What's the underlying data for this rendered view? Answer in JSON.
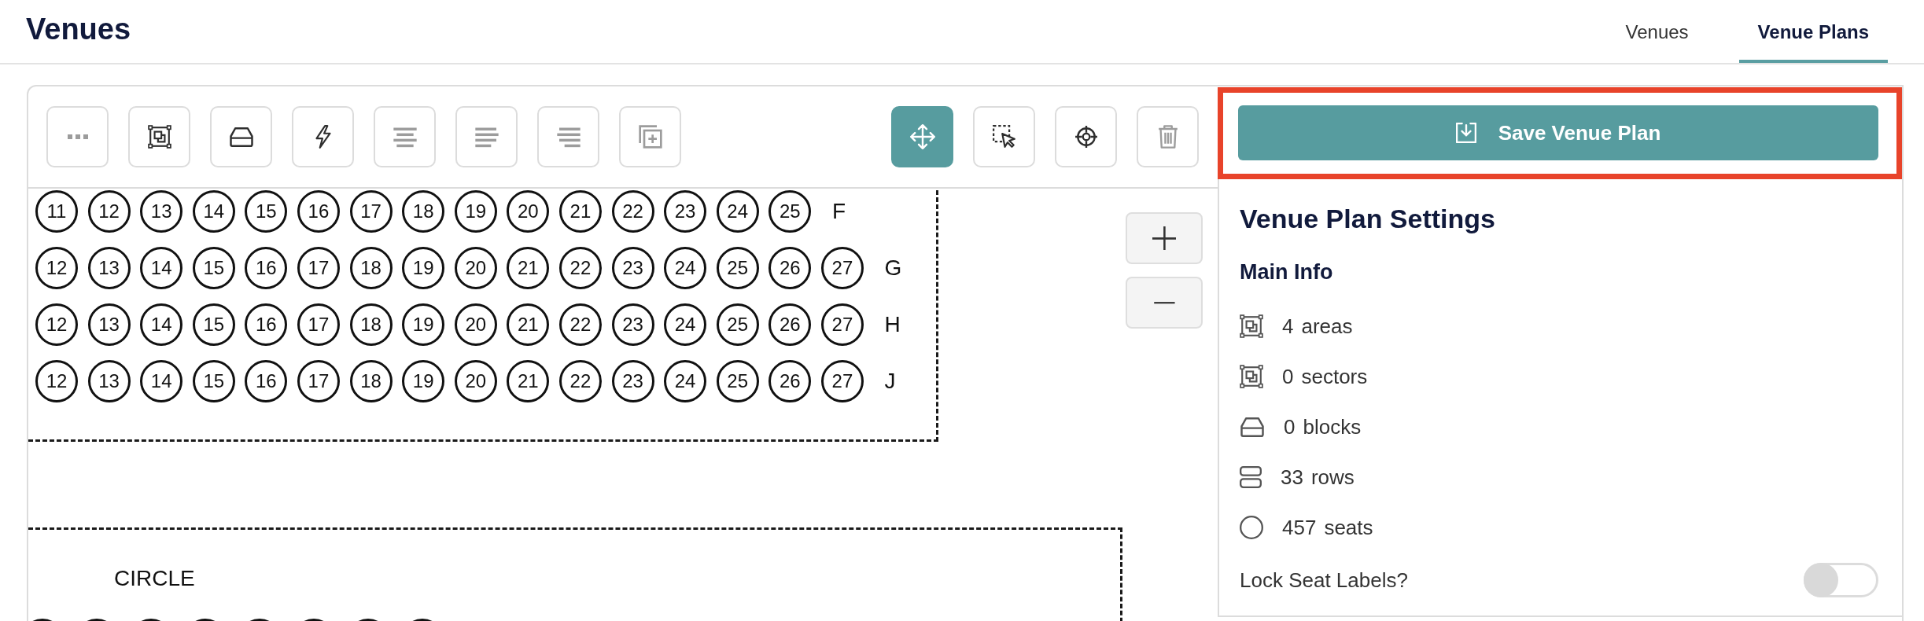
{
  "header": {
    "title": "Venues",
    "tabs": [
      {
        "label": "Venues",
        "selected": false
      },
      {
        "label": "Venue Plans",
        "selected": true
      }
    ]
  },
  "toolbar": {
    "tools": [
      {
        "kind": "more",
        "disabled": true,
        "selected": false
      },
      {
        "kind": "area",
        "disabled": false,
        "selected": false
      },
      {
        "kind": "block",
        "disabled": false,
        "selected": false
      },
      {
        "kind": "lightning",
        "disabled": false,
        "selected": false
      },
      {
        "kind": "align-center",
        "disabled": true,
        "selected": false
      },
      {
        "kind": "align-left",
        "disabled": true,
        "selected": false
      },
      {
        "kind": "align-right",
        "disabled": true,
        "selected": false
      },
      {
        "kind": "copy",
        "disabled": true,
        "selected": false
      }
    ],
    "tools_right": [
      {
        "kind": "move",
        "disabled": false,
        "selected": true
      },
      {
        "kind": "select",
        "disabled": false,
        "selected": false
      },
      {
        "kind": "target",
        "disabled": false,
        "selected": false
      },
      {
        "kind": "delete",
        "disabled": true,
        "selected": false
      }
    ]
  },
  "seat_map": {
    "section": {
      "rows": [
        {
          "label": "F",
          "seats": [
            "11",
            "12",
            "13",
            "14",
            "15",
            "16",
            "17",
            "18",
            "19",
            "20",
            "21",
            "22",
            "23",
            "24",
            "25"
          ]
        },
        {
          "label": "G",
          "seats": [
            "12",
            "13",
            "14",
            "15",
            "16",
            "17",
            "18",
            "19",
            "20",
            "21",
            "22",
            "23",
            "24",
            "25",
            "26",
            "27"
          ]
        },
        {
          "label": "H",
          "seats": [
            "12",
            "13",
            "14",
            "15",
            "16",
            "17",
            "18",
            "19",
            "20",
            "21",
            "22",
            "23",
            "24",
            "25",
            "26",
            "27"
          ]
        },
        {
          "label": "J",
          "seats": [
            "12",
            "13",
            "14",
            "15",
            "16",
            "17",
            "18",
            "19",
            "20",
            "21",
            "22",
            "23",
            "24",
            "25",
            "26",
            "27"
          ]
        }
      ]
    },
    "circle_section": {
      "label": "CIRCLE"
    }
  },
  "save_button": {
    "label": "Save Venue Plan",
    "highlighted": true
  },
  "settings": {
    "title": "Venue Plan Settings",
    "subtitle": "Main Info",
    "stats": [
      {
        "kind": "area",
        "count": "4",
        "label": "areas"
      },
      {
        "kind": "sector",
        "count": "0",
        "label": "sectors"
      },
      {
        "kind": "block",
        "count": "0",
        "label": "blocks"
      },
      {
        "kind": "row",
        "count": "33",
        "label": "rows"
      },
      {
        "kind": "seat",
        "count": "457",
        "label": "seats"
      }
    ],
    "lock_seat_labels": {
      "label": "Lock Seat Labels?",
      "on": false
    }
  }
}
